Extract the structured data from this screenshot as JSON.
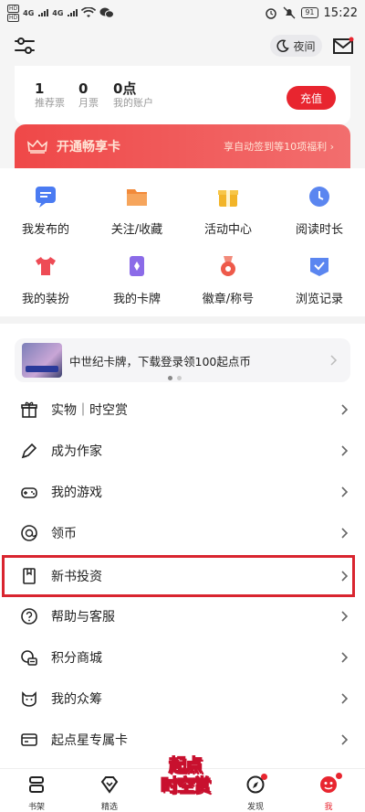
{
  "status": {
    "sim1": "HD",
    "sim2": "HD",
    "net1": "4G",
    "net2": "4G",
    "battery": "91",
    "time": "15:22"
  },
  "header": {
    "night_label": "夜间"
  },
  "account": {
    "stats": [
      {
        "value": "1",
        "label": "推荐票"
      },
      {
        "value": "0",
        "label": "月票"
      },
      {
        "value": "0点",
        "label": "我的账户"
      }
    ],
    "recharge_label": "充值"
  },
  "vip": {
    "title": "开通畅享卡",
    "promo": "享自动签到等10项福利 ›"
  },
  "grid": [
    {
      "label": "我发布的",
      "icon": "post-icon",
      "color": "#4a7bf2"
    },
    {
      "label": "关注/收藏",
      "icon": "folder-icon",
      "color": "#f28a3a"
    },
    {
      "label": "活动中心",
      "icon": "gift-box-icon",
      "color": "#f2b428"
    },
    {
      "label": "阅读时长",
      "icon": "clock-icon",
      "color": "#5b86f0"
    },
    {
      "label": "我的装扮",
      "icon": "tshirt-icon",
      "color": "#ee4b55"
    },
    {
      "label": "我的卡牌",
      "icon": "card-icon",
      "color": "#8b6be8"
    },
    {
      "label": "徽章/称号",
      "icon": "medal-icon",
      "color": "#ee5a4a"
    },
    {
      "label": "浏览记录",
      "icon": "history-icon",
      "color": "#5b86f0"
    }
  ],
  "promo_banner": {
    "text": "中世纪卡牌，下载登录领100起点币"
  },
  "menu": [
    {
      "label": "实物｜时空赏",
      "icon": "gift-icon"
    },
    {
      "label": "成为作家",
      "icon": "pen-icon"
    },
    {
      "label": "我的游戏",
      "icon": "gamepad-icon"
    },
    {
      "label": "领币",
      "icon": "coin-icon"
    },
    {
      "label": "新书投资",
      "icon": "bookmark-icon"
    },
    {
      "label": "帮助与客服",
      "icon": "help-icon"
    },
    {
      "label": "积分商城",
      "icon": "points-icon"
    },
    {
      "label": "我的众筹",
      "icon": "crowdfund-icon"
    },
    {
      "label": "起点星专属卡",
      "icon": "card-outline-icon"
    }
  ],
  "bottom_nav": {
    "items": [
      {
        "label": "书架"
      },
      {
        "label": "精选"
      },
      {
        "label": "发现"
      },
      {
        "label": "我"
      }
    ],
    "center_logo_line1": "起点",
    "center_logo_line2": "时空赏"
  },
  "colors": {
    "accent": "#e8252f",
    "highlight_box": "#d9252f"
  }
}
